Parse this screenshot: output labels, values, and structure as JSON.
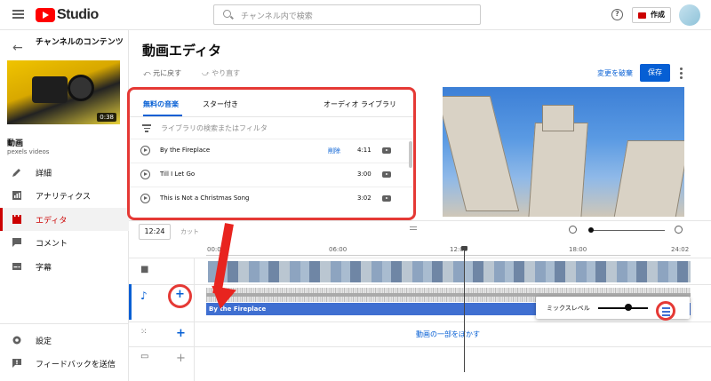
{
  "topbar": {
    "app": "Studio",
    "search_placeholder": "チャンネル内で検索",
    "help": "?",
    "create": "作成"
  },
  "sidebar": {
    "channel_title": "チャンネルのコンテンツ",
    "duration": "0:38",
    "video_label": "動画",
    "video_sub": "pexels videos",
    "items": [
      {
        "label": "詳細",
        "icon": "pencil-icon"
      },
      {
        "label": "アナリティクス",
        "icon": "analytics-icon"
      },
      {
        "label": "エディタ",
        "icon": "editor-icon",
        "active": true
      },
      {
        "label": "コメント",
        "icon": "comment-icon"
      },
      {
        "label": "字幕",
        "icon": "subtitles-icon"
      }
    ],
    "settings": "設定",
    "feedback": "フィードバックを送信"
  },
  "editor": {
    "title": "動画エディタ",
    "undo": "元に戻す",
    "redo": "やり直す",
    "discard": "変更を破棄",
    "save": "保存"
  },
  "audio_panel": {
    "tabs": [
      "無料の音楽",
      "スター付き",
      "オーディオ ライブラリ"
    ],
    "filter_placeholder": "ライブラリの検索またはフィルタ",
    "tracks": [
      {
        "name": "By the Fireplace",
        "delete": "削除",
        "duration": "4:11"
      },
      {
        "name": "Till I Let Go",
        "delete": "",
        "duration": "3:00"
      },
      {
        "name": "This is Not a Christmas Song",
        "delete": "",
        "duration": "3:02"
      }
    ]
  },
  "timeline": {
    "timecode": "12:24",
    "cut": "カット",
    "ruler": [
      "00:00",
      "06:00",
      "12:00",
      "18:00",
      "24:02"
    ],
    "audio_track": "By the Fireplace",
    "blur_label": "動画の一部をぼかす",
    "mix_label": "ミックスレベル",
    "mix_level": 0.6
  },
  "colors": {
    "brand": "#ff0000",
    "accent": "#065fd4",
    "annotation": "#e53935"
  }
}
